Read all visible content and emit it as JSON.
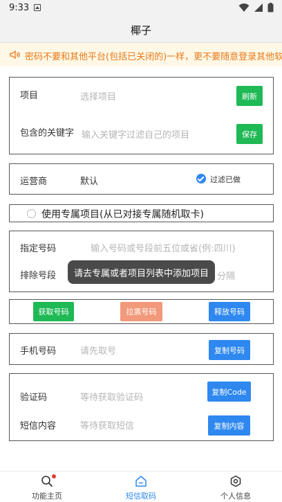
{
  "status_bar": {
    "time": "9:33"
  },
  "app_title": "椰子",
  "notice": "密码不要和其他平台(包括已关闭的)一样，更不要随意登录其他软件",
  "project_card": {
    "project_label": "项目",
    "project_placeholder": "选择项目",
    "refresh_label": "刷新",
    "keyword_label": "包含的关键字",
    "keyword_placeholder": "输入关键字过滤自己的项目",
    "save_label": "保存"
  },
  "operator_card": {
    "label": "运营商",
    "value": "默认",
    "filter_label": "过滤已做"
  },
  "exclusive": {
    "label": "使用专属项目(从已对接专属随机取卡)"
  },
  "number_card": {
    "specify_label": "指定号码",
    "specify_placeholder": "输入号码或号段前五位或省(例:四川)",
    "exclude_label": "排除号段",
    "exclude_placeholder": "分隔"
  },
  "toast": "请去专属或者项目列表中添加项目",
  "actions": {
    "get_label": "获取号码",
    "block_label": "拉黑号码",
    "release_label": "释放号码"
  },
  "phone_card": {
    "label": "手机号码",
    "placeholder": "请先取号",
    "copy_label": "复制号码"
  },
  "sms_card": {
    "code_label": "验证码",
    "code_placeholder": "等待获取验证码",
    "copy_code_label": "复制Code",
    "sms_label": "短信内容",
    "sms_placeholder": "等待获取短信",
    "copy_sms_label": "复制内容"
  },
  "nav": {
    "items": [
      {
        "label": "功能主页",
        "icon": "search-icon"
      },
      {
        "label": "短信取码",
        "icon": "home-icon"
      },
      {
        "label": "个人信息",
        "icon": "gear-icon"
      }
    ],
    "active_color": "#2e88f0"
  },
  "colors": {
    "green": "#1fb955",
    "blue": "#2e88f0",
    "orange": "#f1997a",
    "notice": "#e8791a"
  }
}
